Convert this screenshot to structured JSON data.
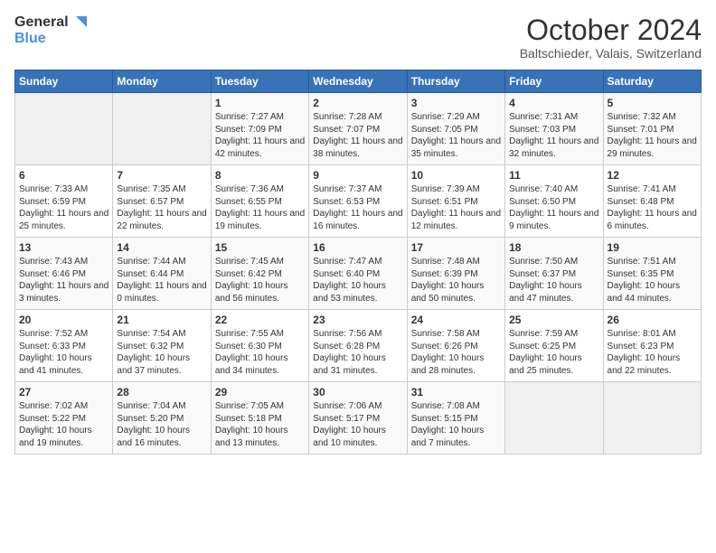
{
  "header": {
    "logo_general": "General",
    "logo_blue": "Blue",
    "month_title": "October 2024",
    "location": "Baltschieder, Valais, Switzerland"
  },
  "days_of_week": [
    "Sunday",
    "Monday",
    "Tuesday",
    "Wednesday",
    "Thursday",
    "Friday",
    "Saturday"
  ],
  "weeks": [
    [
      {
        "day": "",
        "empty": true
      },
      {
        "day": "",
        "empty": true
      },
      {
        "day": "1",
        "sunrise": "7:27 AM",
        "sunset": "7:09 PM",
        "daylight": "11 hours and 42 minutes."
      },
      {
        "day": "2",
        "sunrise": "7:28 AM",
        "sunset": "7:07 PM",
        "daylight": "11 hours and 38 minutes."
      },
      {
        "day": "3",
        "sunrise": "7:29 AM",
        "sunset": "7:05 PM",
        "daylight": "11 hours and 35 minutes."
      },
      {
        "day": "4",
        "sunrise": "7:31 AM",
        "sunset": "7:03 PM",
        "daylight": "11 hours and 32 minutes."
      },
      {
        "day": "5",
        "sunrise": "7:32 AM",
        "sunset": "7:01 PM",
        "daylight": "11 hours and 29 minutes."
      }
    ],
    [
      {
        "day": "6",
        "sunrise": "7:33 AM",
        "sunset": "6:59 PM",
        "daylight": "11 hours and 25 minutes."
      },
      {
        "day": "7",
        "sunrise": "7:35 AM",
        "sunset": "6:57 PM",
        "daylight": "11 hours and 22 minutes."
      },
      {
        "day": "8",
        "sunrise": "7:36 AM",
        "sunset": "6:55 PM",
        "daylight": "11 hours and 19 minutes."
      },
      {
        "day": "9",
        "sunrise": "7:37 AM",
        "sunset": "6:53 PM",
        "daylight": "11 hours and 16 minutes."
      },
      {
        "day": "10",
        "sunrise": "7:39 AM",
        "sunset": "6:51 PM",
        "daylight": "11 hours and 12 minutes."
      },
      {
        "day": "11",
        "sunrise": "7:40 AM",
        "sunset": "6:50 PM",
        "daylight": "11 hours and 9 minutes."
      },
      {
        "day": "12",
        "sunrise": "7:41 AM",
        "sunset": "6:48 PM",
        "daylight": "11 hours and 6 minutes."
      }
    ],
    [
      {
        "day": "13",
        "sunrise": "7:43 AM",
        "sunset": "6:46 PM",
        "daylight": "11 hours and 3 minutes."
      },
      {
        "day": "14",
        "sunrise": "7:44 AM",
        "sunset": "6:44 PM",
        "daylight": "11 hours and 0 minutes."
      },
      {
        "day": "15",
        "sunrise": "7:45 AM",
        "sunset": "6:42 PM",
        "daylight": "10 hours and 56 minutes."
      },
      {
        "day": "16",
        "sunrise": "7:47 AM",
        "sunset": "6:40 PM",
        "daylight": "10 hours and 53 minutes."
      },
      {
        "day": "17",
        "sunrise": "7:48 AM",
        "sunset": "6:39 PM",
        "daylight": "10 hours and 50 minutes."
      },
      {
        "day": "18",
        "sunrise": "7:50 AM",
        "sunset": "6:37 PM",
        "daylight": "10 hours and 47 minutes."
      },
      {
        "day": "19",
        "sunrise": "7:51 AM",
        "sunset": "6:35 PM",
        "daylight": "10 hours and 44 minutes."
      }
    ],
    [
      {
        "day": "20",
        "sunrise": "7:52 AM",
        "sunset": "6:33 PM",
        "daylight": "10 hours and 41 minutes."
      },
      {
        "day": "21",
        "sunrise": "7:54 AM",
        "sunset": "6:32 PM",
        "daylight": "10 hours and 37 minutes."
      },
      {
        "day": "22",
        "sunrise": "7:55 AM",
        "sunset": "6:30 PM",
        "daylight": "10 hours and 34 minutes."
      },
      {
        "day": "23",
        "sunrise": "7:56 AM",
        "sunset": "6:28 PM",
        "daylight": "10 hours and 31 minutes."
      },
      {
        "day": "24",
        "sunrise": "7:58 AM",
        "sunset": "6:26 PM",
        "daylight": "10 hours and 28 minutes."
      },
      {
        "day": "25",
        "sunrise": "7:59 AM",
        "sunset": "6:25 PM",
        "daylight": "10 hours and 25 minutes."
      },
      {
        "day": "26",
        "sunrise": "8:01 AM",
        "sunset": "6:23 PM",
        "daylight": "10 hours and 22 minutes."
      }
    ],
    [
      {
        "day": "27",
        "sunrise": "7:02 AM",
        "sunset": "5:22 PM",
        "daylight": "10 hours and 19 minutes."
      },
      {
        "day": "28",
        "sunrise": "7:04 AM",
        "sunset": "5:20 PM",
        "daylight": "10 hours and 16 minutes."
      },
      {
        "day": "29",
        "sunrise": "7:05 AM",
        "sunset": "5:18 PM",
        "daylight": "10 hours and 13 minutes."
      },
      {
        "day": "30",
        "sunrise": "7:06 AM",
        "sunset": "5:17 PM",
        "daylight": "10 hours and 10 minutes."
      },
      {
        "day": "31",
        "sunrise": "7:08 AM",
        "sunset": "5:15 PM",
        "daylight": "10 hours and 7 minutes."
      },
      {
        "day": "",
        "empty": true
      },
      {
        "day": "",
        "empty": true
      }
    ]
  ],
  "labels": {
    "sunrise": "Sunrise:",
    "sunset": "Sunset:",
    "daylight": "Daylight:"
  }
}
